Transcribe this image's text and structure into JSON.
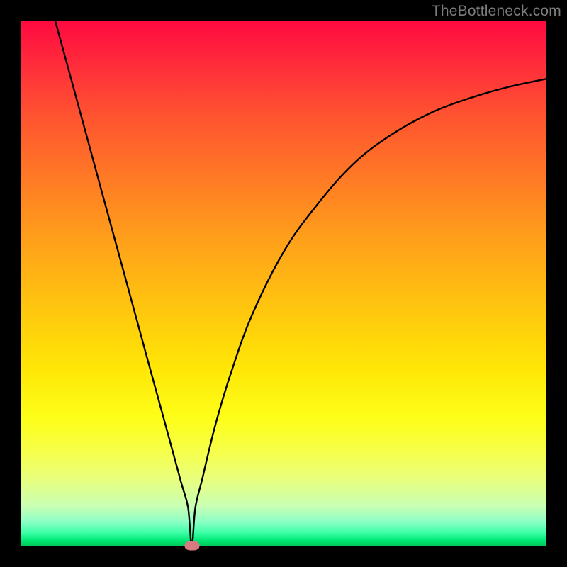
{
  "watermark": "TheBottleneck.com",
  "chart_data": {
    "type": "line",
    "title": "",
    "xlabel": "",
    "ylabel": "",
    "xlim": [
      0,
      100
    ],
    "ylim": [
      0,
      100
    ],
    "grid": false,
    "series": [
      {
        "name": "curve",
        "color": "#000000",
        "x": [
          6.5,
          10,
          15,
          20,
          24,
          28,
          30.5,
          31.8,
          32.5,
          33.2,
          34.5,
          37,
          40,
          44,
          50,
          56,
          63,
          70,
          78,
          86,
          93,
          100
        ],
        "y": [
          100,
          87.2,
          68.8,
          50.5,
          35.8,
          21.2,
          12.0,
          7.3,
          0.0,
          7.3,
          12.7,
          23.0,
          33.0,
          44.0,
          56.0,
          64.5,
          72.5,
          78.0,
          82.5,
          85.5,
          87.5,
          89.0
        ]
      }
    ],
    "marker": {
      "x": 32.5,
      "y": 0,
      "color": "#d97a82"
    }
  }
}
